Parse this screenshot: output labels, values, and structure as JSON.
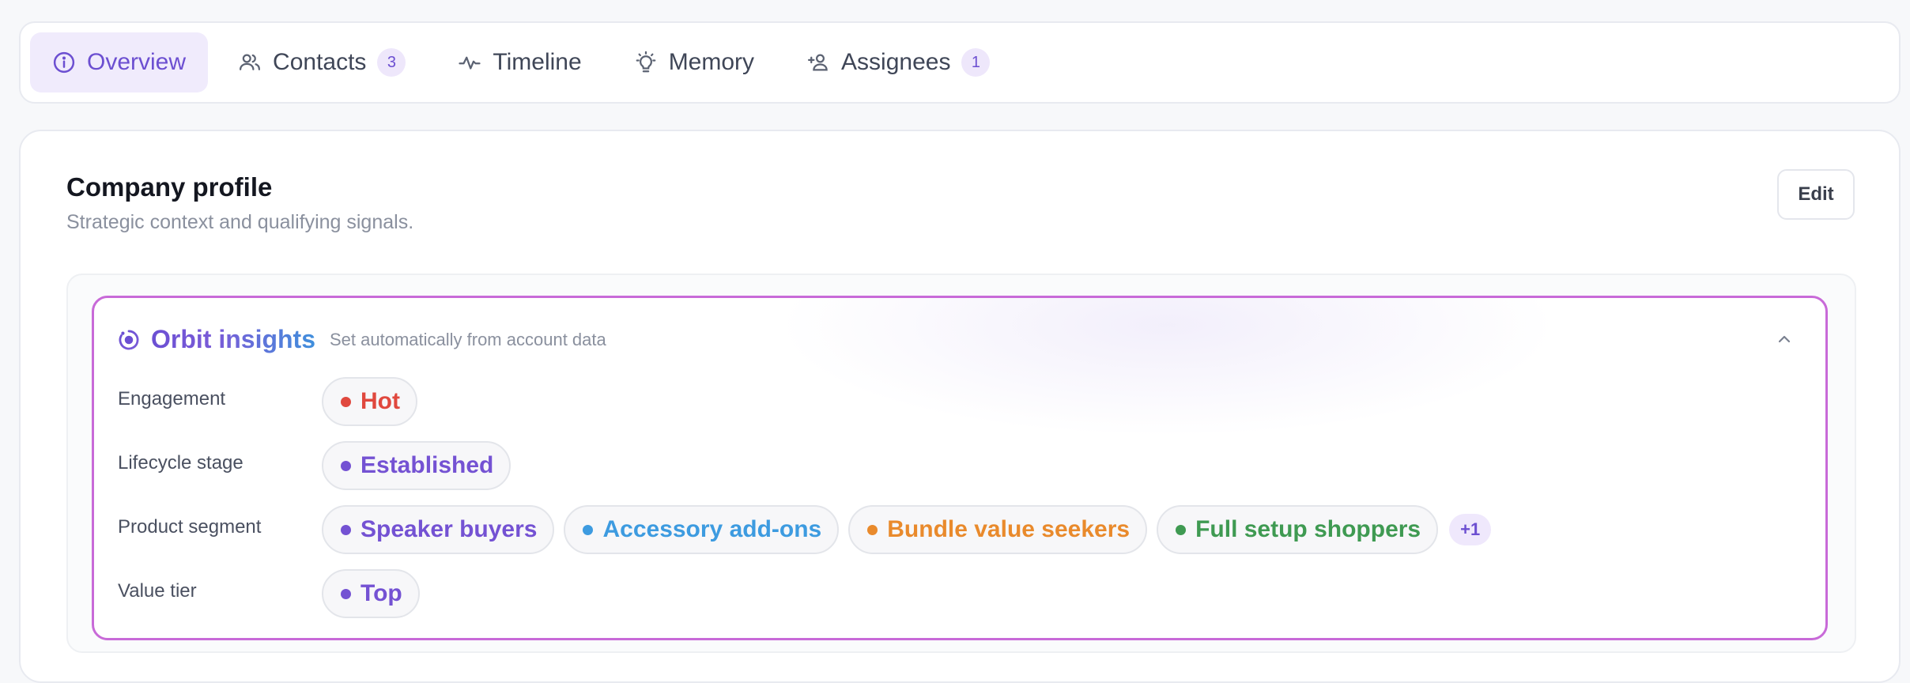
{
  "tabs": [
    {
      "label": "Overview",
      "icon": "info-circle-icon",
      "active": true
    },
    {
      "label": "Contacts",
      "icon": "users-icon",
      "count": "3"
    },
    {
      "label": "Timeline",
      "icon": "activity-icon"
    },
    {
      "label": "Memory",
      "icon": "lightbulb-icon"
    },
    {
      "label": "Assignees",
      "icon": "user-plus-icon",
      "count": "1"
    }
  ],
  "card": {
    "title": "Company profile",
    "subtitle": "Strategic context and qualifying signals.",
    "edit_label": "Edit"
  },
  "insights": {
    "title": "Orbit insights",
    "subtitle": "Set automatically from account data",
    "rows": [
      {
        "label": "Engagement",
        "chips": [
          {
            "text": "Hot",
            "color": "#e0483e"
          }
        ]
      },
      {
        "label": "Lifecycle stage",
        "chips": [
          {
            "text": "Established",
            "color": "#7452d3"
          }
        ]
      },
      {
        "label": "Product segment",
        "chips": [
          {
            "text": "Speaker buyers",
            "color": "#7452d3"
          },
          {
            "text": "Accessory add-ons",
            "color": "#3d9be0"
          },
          {
            "text": "Bundle value seekers",
            "color": "#e98a2c"
          },
          {
            "text": "Full setup shoppers",
            "color": "#3f9a52"
          }
        ],
        "more": "+1"
      },
      {
        "label": "Value tier",
        "chips": [
          {
            "text": "Top",
            "color": "#7452d3"
          }
        ]
      }
    ]
  },
  "colors": {
    "accent": "#6c4fd1",
    "border_gradient": "#c86ad8"
  }
}
